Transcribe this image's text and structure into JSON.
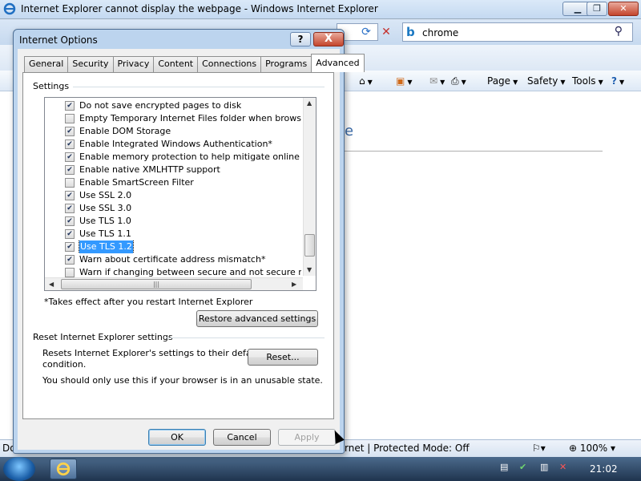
{
  "ie_window": {
    "title": "Internet Explorer cannot display the webpage - Windows Internet Explorer",
    "search_text": "chrome",
    "command_bar": {
      "page": "Page",
      "safety": "Safety",
      "tools": "Tools"
    },
    "content_heading_fragment": "e",
    "status": {
      "left_fragment": "Do",
      "zone": "rnet | Protected Mode: Off",
      "zoom": "100%"
    }
  },
  "dialog": {
    "title": "Internet Options",
    "help_label": "?",
    "close_label": "X",
    "tabs": [
      "General",
      "Security",
      "Privacy",
      "Content",
      "Connections",
      "Programs",
      "Advanced"
    ],
    "active_tab": "Advanced",
    "settings_group_label": "Settings",
    "settings_items": [
      {
        "label": "Do not save encrypted pages to disk",
        "checked": true
      },
      {
        "label": "Empty Temporary Internet Files folder when browser is clo",
        "checked": false
      },
      {
        "label": "Enable DOM Storage",
        "checked": true
      },
      {
        "label": "Enable Integrated Windows Authentication*",
        "checked": true
      },
      {
        "label": "Enable memory protection to help mitigate online attacks*",
        "checked": true
      },
      {
        "label": "Enable native XMLHTTP support",
        "checked": true
      },
      {
        "label": "Enable SmartScreen Filter",
        "checked": false
      },
      {
        "label": "Use SSL 2.0",
        "checked": true
      },
      {
        "label": "Use SSL 3.0",
        "checked": true
      },
      {
        "label": "Use TLS 1.0",
        "checked": true
      },
      {
        "label": "Use TLS 1.1",
        "checked": true
      },
      {
        "label": "Use TLS 1.2",
        "checked": true,
        "selected": true
      },
      {
        "label": "Warn about certificate address mismatch*",
        "checked": true
      },
      {
        "label": "Warn if changing between secure and not secure mode",
        "checked": false
      }
    ],
    "restart_note": "*Takes effect after you restart Internet Explorer",
    "restore_button": "Restore advanced settings",
    "reset_group_label": "Reset Internet Explorer settings",
    "reset_description_line1": "Resets Internet Explorer's settings to their default",
    "reset_description_line2": "condition.",
    "reset_button": "Reset...",
    "reset_warning": "You should only use this if your browser is in an unusable state.",
    "ok_button": "OK",
    "cancel_button": "Cancel",
    "apply_button": "Apply"
  },
  "taskbar": {
    "clock": "21:02"
  },
  "colors": {
    "selection": "#3399ff",
    "title_bar": "#c4d9f1",
    "close_red": "#c4452c"
  }
}
